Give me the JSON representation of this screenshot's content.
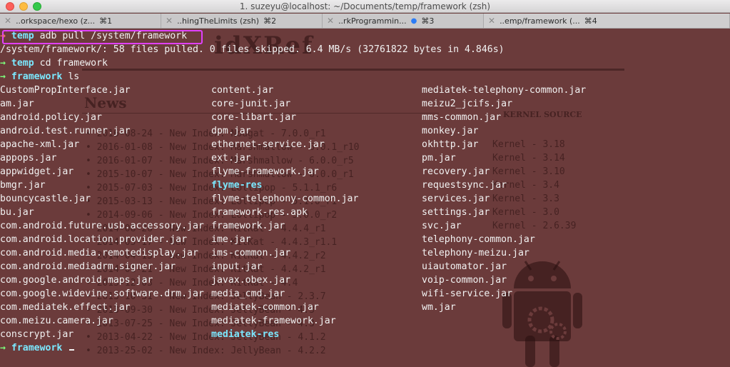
{
  "window": {
    "title": "1. suzeyu@localhost: ~/Documents/temp/framework (zsh)"
  },
  "tabs": [
    {
      "label": "..orkspace/hexo (z...",
      "shortcut": "⌘1"
    },
    {
      "label": "..hingTheLimits (zsh)",
      "shortcut": "⌘2"
    },
    {
      "label": "..rkProgrammin...",
      "shortcut": "⌘3",
      "dot": "●"
    },
    {
      "label": "..emp/framework (...",
      "shortcut": "⌘4"
    }
  ],
  "terminal": {
    "arrow": "→",
    "lines": [
      {
        "type": "prompt",
        "arrow_color": "red",
        "dir": "temp",
        "cmd": "adb pull /system/framework"
      },
      {
        "type": "output",
        "text": "/system/framework/: 58 files pulled. 0 files skipped. 6.4 MB/s (32761822 bytes in 4.846s)"
      },
      {
        "type": "prompt",
        "arrow_color": "green",
        "dir": "temp",
        "cmd": "cd framework"
      },
      {
        "type": "prompt",
        "arrow_color": "green",
        "dir": "framework",
        "cmd": "ls"
      }
    ],
    "ls_columns": [
      [
        "CustomPropInterface.jar",
        "am.jar",
        "android.policy.jar",
        "android.test.runner.jar",
        "apache-xml.jar",
        "appops.jar",
        "appwidget.jar",
        "bmgr.jar",
        "bouncycastle.jar",
        "bu.jar",
        "com.android.future.usb.accessory.jar",
        "com.android.location.provider.jar",
        "com.android.media.remotedisplay.jar",
        "com.android.mediadrm.signer.jar",
        "com.google.android.maps.jar",
        "com.google.widevine.software.drm.jar",
        "com.mediatek.effect.jar",
        "com.meizu.camera.jar",
        "conscrypt.jar"
      ],
      [
        "content.jar",
        "core-junit.jar",
        "core-libart.jar",
        "dpm.jar",
        "ethernet-service.jar",
        "ext.jar",
        "flyme-framework.jar",
        "flyme-res",
        "flyme-telephony-common.jar",
        "framework-res.apk",
        "framework.jar",
        "ime.jar",
        "ims-common.jar",
        "input.jar",
        "javax.obex.jar",
        "media_cmd.jar",
        "mediatek-common.jar",
        "mediatek-framework.jar",
        "mediatek-res"
      ],
      [
        "mediatek-telephony-common.jar",
        "meizu2_jcifs.jar",
        "mms-common.jar",
        "monkey.jar",
        "okhttp.jar",
        "pm.jar",
        "recovery.jar",
        "requestsync.jar",
        "services.jar",
        "settings.jar",
        "svc.jar",
        "telephony-common.jar",
        "telephony-meizu.jar",
        "uiautomator.jar",
        "voip-common.jar",
        "wifi-service.jar",
        "wm.jar"
      ]
    ],
    "directories": [
      "flyme-res",
      "mediatek-res"
    ],
    "final_prompt": {
      "dir": "framework"
    }
  },
  "background": {
    "site_title": "idXRef",
    "news": "News",
    "kernel_source": "KERNEL SOURCE",
    "items": [
      "• 2016-08-24 - New Index: Nougat - 7.0.0_r1",
      "• 2016-01-08 - New Index: Marshmallow - 6.0.1_r10",
      "• 2016-01-07 - New Index: Marshmallow - 6.0.0_r5",
      "• 2015-10-07 - New Index: Marshmallow - 6.0.0_r1",
      "• 2015-07-03 - New Index: Lollipop - 5.1.1_r6",
      "• 2015-03-13 - New Index: Lollipop - 5.1.0_r1",
      "• 2014-09-06 - New Index: Lollipop - 5.0.0_r2",
      "• 2014-08-26 - New Index: KitKat - 4.4.4_r1",
      "• 2014-05-17 - New Index: KitKat - 4.4.3_r1.1",
      "• 2014-04-13 - New Index: KitKat - 4.4.2_r2",
      "• 2014-01-21 - New Index: KitKat - 4.4.2_r1",
      "• 2013-12-03 - New Index: KitKat - 4.4",
      "• 2013-10-31 - New Index: JellyBean - 2.3.7",
      "• 2013-09-30 - New Index: JellyBean - 4.3",
      "• 2013-07-25 - New Index: JellyBean - 4.3",
      "• 2013-04-22 - New Index: JellyBean - 4.1.2",
      "• 2013-25-02 - New Index: JellyBean - 4.2.2"
    ],
    "kernels": [
      "Kernel - 3.18",
      "Kernel - 3.14",
      "Kernel - 3.10",
      "Kernel - 3.4",
      "Kernel - 3.3",
      "Kernel - 3.0",
      "Kernel - 2.6.39"
    ]
  }
}
